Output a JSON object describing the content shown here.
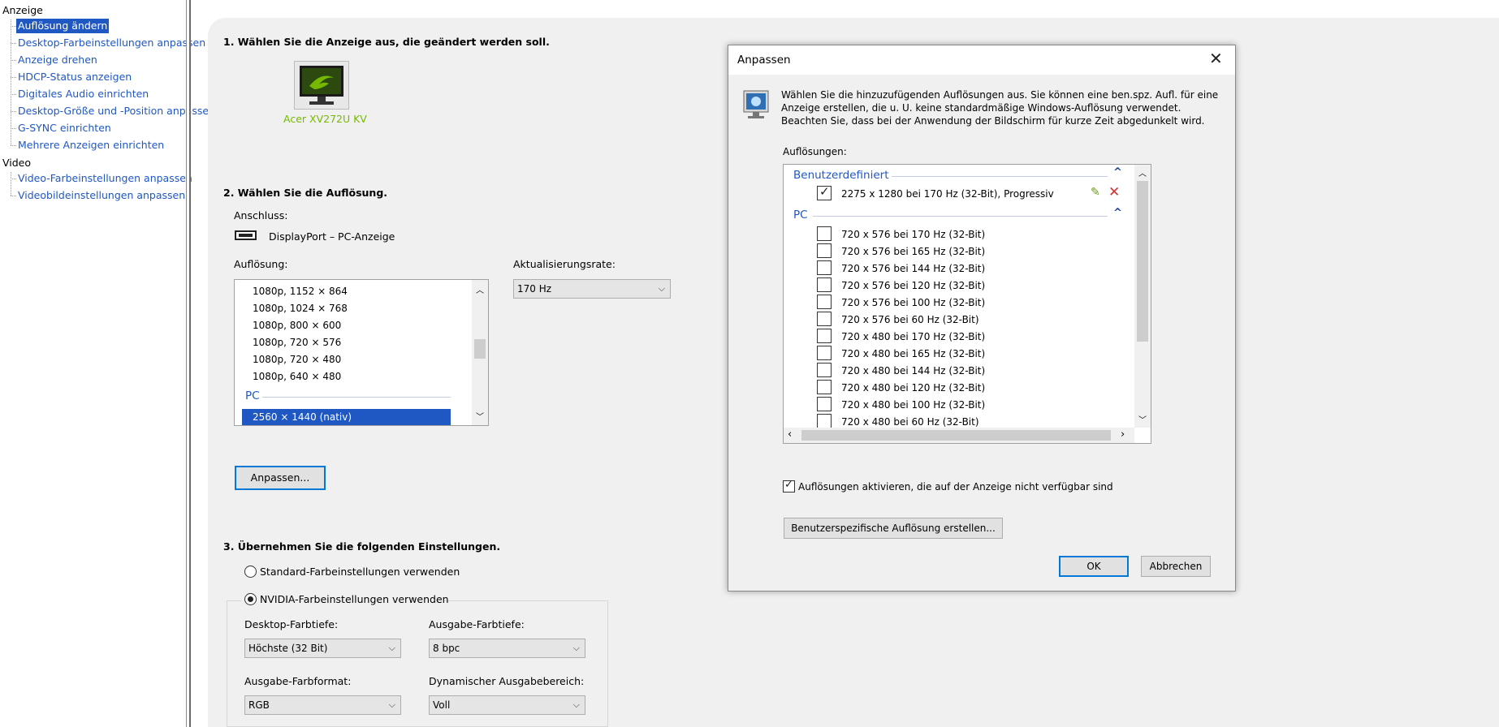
{
  "sidebar": {
    "categories": [
      "Anzeige",
      "Video"
    ],
    "display_items": [
      "Auflösung ändern",
      "Desktop-Farbeinstellungen anpassen",
      "Anzeige drehen",
      "HDCP-Status anzeigen",
      "Digitales Audio einrichten",
      "Desktop-Größe und -Position anpassen",
      "G-SYNC einrichten",
      "Mehrere Anzeigen einrichten"
    ],
    "video_items": [
      "Video-Farbeinstellungen anpassen",
      "Videobildeinstellungen anpassen"
    ]
  },
  "main": {
    "step1_heading": "1. Wählen Sie die Anzeige aus, die geändert werden soll.",
    "monitor_name": "Acer XV272U KV",
    "step2_heading": "2. Wählen Sie die Auflösung.",
    "connector_label": "Anschluss:",
    "connector_value": "DisplayPort – PC-Anzeige",
    "resolution_label": "Auflösung:",
    "resolutions": [
      "1080p, 1152 × 864",
      "1080p, 1024 × 768",
      "1080p, 800 × 600",
      "1080p, 720 × 576",
      "1080p, 720 × 480",
      "1080p, 640 × 480"
    ],
    "resolution_group": "PC",
    "resolution_selected": "2560 × 1440 (nativ)",
    "refresh_label": "Aktualisierungsrate:",
    "refresh_value": "170 Hz",
    "customize_button": "Anpassen...",
    "step3_heading": "3. Übernehmen Sie die folgenden Einstellungen.",
    "radio_standard": "Standard-Farbeinstellungen verwenden",
    "radio_nvidia": "NVIDIA-Farbeinstellungen verwenden",
    "desktop_depth_label": "Desktop-Farbtiefe:",
    "desktop_depth_value": "Höchste (32 Bit)",
    "output_depth_label": "Ausgabe-Farbtiefe:",
    "output_depth_value": "8 bpc",
    "output_format_label": "Ausgabe-Farbformat:",
    "output_format_value": "RGB",
    "dynamic_range_label": "Dynamischer Ausgabebereich:",
    "dynamic_range_value": "Voll"
  },
  "dialog": {
    "title": "Anpassen",
    "description": "Wählen Sie die hinzuzufügenden Auflösungen aus. Sie können eine ben.spz. Aufl. für eine Anzeige erstellen, die u. U. keine standardmäßige Windows-Auflösung verwendet. Beachten Sie, dass bei der Anwendung der Bildschirm für kurze Zeit abgedunkelt wird.",
    "resolutions_label": "Auflösungen:",
    "group_custom": "Benutzerdefiniert",
    "custom_item": "2275 x 1280 bei 170 Hz (32-Bit), Progressiv",
    "group_pc": "PC",
    "pc_items": [
      "720 x 576 bei 170 Hz (32-Bit)",
      "720 x 576 bei 165 Hz (32-Bit)",
      "720 x 576 bei 144 Hz (32-Bit)",
      "720 x 576 bei 120 Hz (32-Bit)",
      "720 x 576 bei 100 Hz (32-Bit)",
      "720 x 576 bei 60 Hz (32-Bit)",
      "720 x 480 bei 170 Hz (32-Bit)",
      "720 x 480 bei 165 Hz (32-Bit)",
      "720 x 480 bei 144 Hz (32-Bit)",
      "720 x 480 bei 120 Hz (32-Bit)",
      "720 x 480 bei 100 Hz (32-Bit)",
      "720 x 480 bei 60 Hz (32-Bit)"
    ],
    "enable_checkbox": "Auflösungen aktivieren, die auf der Anzeige nicht verfügbar sind",
    "create_button": "Benutzerspezifische Auflösung erstellen...",
    "ok_button": "OK",
    "cancel_button": "Abbrechen"
  },
  "colors": {
    "accent": "#1f57c3",
    "nvidia_green": "#76b900",
    "focus": "#0078d7",
    "delete_red": "#d0312d"
  }
}
